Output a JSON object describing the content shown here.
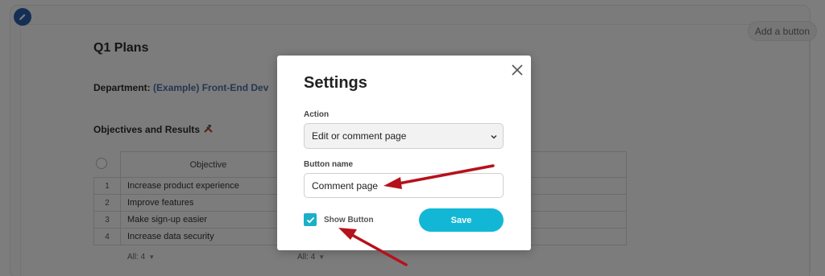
{
  "page": {
    "add_button_label": "Add a button",
    "doc_title": "Q1 Plans",
    "department_label": "Department:",
    "department_value": "(Example) Front-End Dev",
    "section_title": "Objectives and Results",
    "section_icon": "hammer-wrench-icon",
    "table": {
      "header_objective": "Objective",
      "rows": [
        {
          "num": "1",
          "objective": "Increase product experience"
        },
        {
          "num": "2",
          "objective": "Improve features"
        },
        {
          "num": "3",
          "objective": "Make sign-up easier"
        },
        {
          "num": "4",
          "objective": "Increase data security"
        }
      ]
    },
    "footer_left": "All: 4",
    "footer_right": "All: 4"
  },
  "modal": {
    "title": "Settings",
    "action_label": "Action",
    "action_value": "Edit or comment page",
    "button_name_label": "Button name",
    "button_name_value": "Comment page",
    "show_button_label": "Show Button",
    "show_button_checked": true,
    "save_label": "Save"
  },
  "colors": {
    "accent": "#13b7d6",
    "checkbox": "#1ab0c8",
    "annotation_arrow": "#b5121b",
    "edit_badge": "#2b5fa8"
  }
}
